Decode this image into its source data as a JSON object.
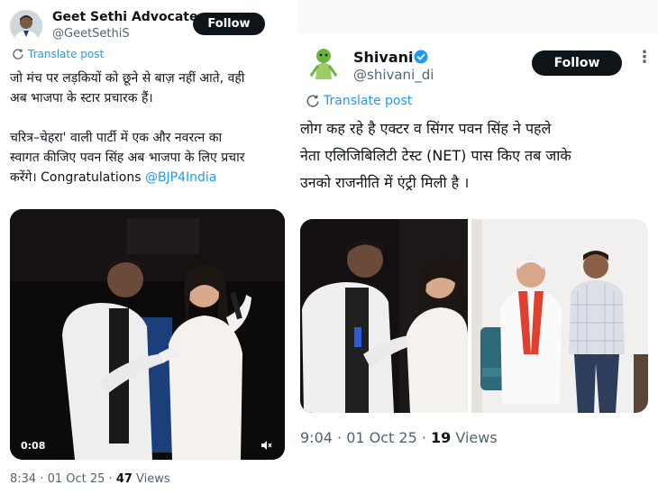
{
  "left_tweet": {
    "author_name": "Geet Sethi Advocate",
    "author_handle": "@GeetSethiS",
    "follow_label": "Follow",
    "translate_label": "Translate post",
    "text_line1": "जो मंच पर लड़कियों को छूने से बाज़ नहीं आते, वही",
    "text_line2": "अब भाजपा के स्टार प्रचारक हैं।",
    "text_line3": "चरित्र–चेहरा' वाली पार्टी में एक और नवरत्न का",
    "text_line4": "स्वागत कीजिए पवन सिंह अब भाजपा के लिए प्रचार",
    "text_line5_prefix": "करेंगे। Congratulations ",
    "mention": "@BJP4India",
    "video_timestamp": "0:08",
    "time": "8:34 · 01 Oct 25 · ",
    "views_count": "47",
    "views_label": " Views",
    "icons": {
      "translate": "translate-icon",
      "mute": "volume-mute-icon"
    }
  },
  "right_tweet": {
    "author_name": "Shivani",
    "author_handle": "@shivani_di",
    "follow_label": "Follow",
    "more_icon": "more-options-icon",
    "verified_icon": "verified-badge-icon",
    "translate_label": "Translate post",
    "text_line1": "लोग कह रहे है एक्टर व सिंगर पवन सिंह ने पहले",
    "text_line2": "नेता एलिजिबिलिटी टेस्ट (NET) पास किए तब जाके",
    "text_line3": "उनको राजनीति में एंट्री मिली है ।",
    "time": "9:04 · 01 Oct 25 · ",
    "views_count": "19",
    "views_label": " Views"
  },
  "colors": {
    "link_blue": "#1d9bf0",
    "verified_blue": "#1d9bf0",
    "secondary_text": "#536471",
    "button_black": "#0f1419"
  }
}
